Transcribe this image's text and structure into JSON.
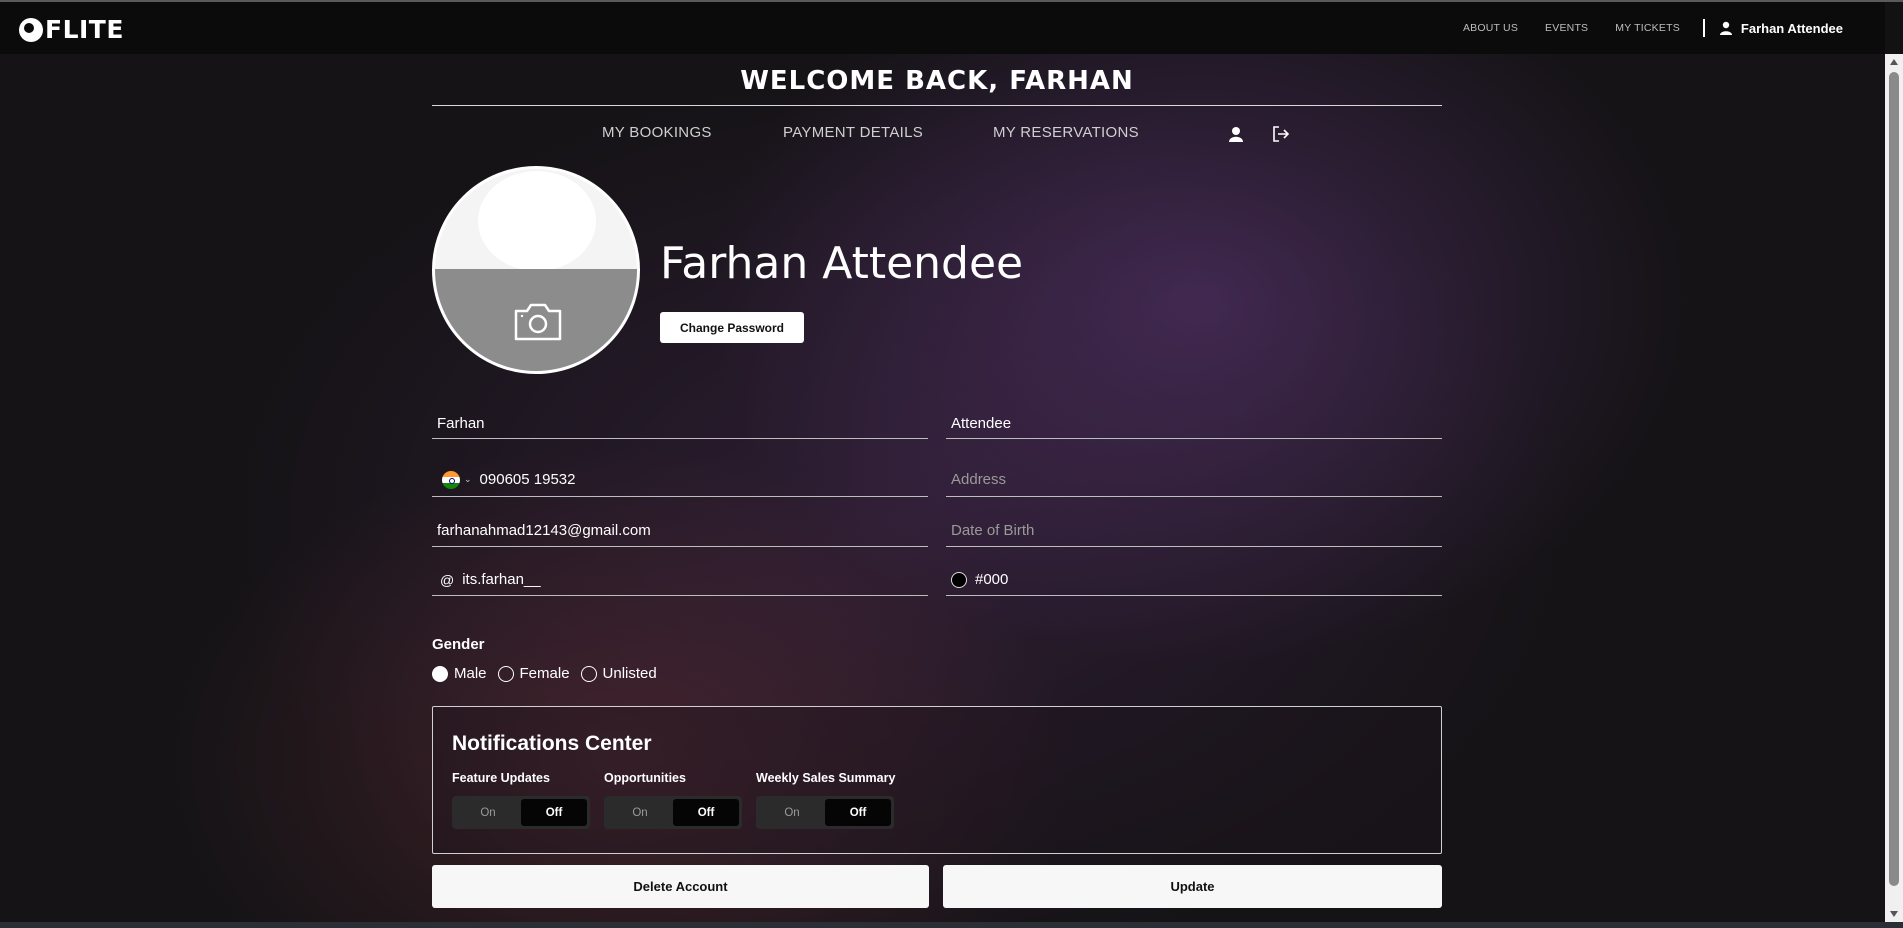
{
  "navbar": {
    "logo": "FLITE",
    "links": [
      "ABOUT US",
      "EVENTS",
      "MY TICKETS"
    ],
    "user_name": "Farhan Attendee"
  },
  "welcome": "WELCOME BACK, FARHAN",
  "tabs": [
    "MY BOOKINGS",
    "PAYMENT DETAILS",
    "MY RESERVATIONS"
  ],
  "profile": {
    "name": "Farhan Attendee",
    "change_password": "Change Password"
  },
  "form": {
    "first_name": "Farhan",
    "last_name": "Attendee",
    "phone": "090605 19532",
    "address_placeholder": "Address",
    "email": "farhanahmad12143@gmail.com",
    "dob_placeholder": "Date of Birth",
    "handle_prefix": "@",
    "handle": "its.farhan__",
    "color_value": "#000"
  },
  "gender": {
    "title": "Gender",
    "options": [
      "Male",
      "Female",
      "Unlisted"
    ],
    "selected": "Male"
  },
  "notifications": {
    "title": "Notifications Center",
    "groups": [
      {
        "label": "Feature Updates",
        "on": "On",
        "off": "Off",
        "value": "Off"
      },
      {
        "label": "Opportunities",
        "on": "On",
        "off": "Off",
        "value": "Off"
      },
      {
        "label": "Weekly Sales Summary",
        "on": "On",
        "off": "Off",
        "value": "Off"
      }
    ]
  },
  "actions": {
    "delete": "Delete Account",
    "update": "Update"
  }
}
